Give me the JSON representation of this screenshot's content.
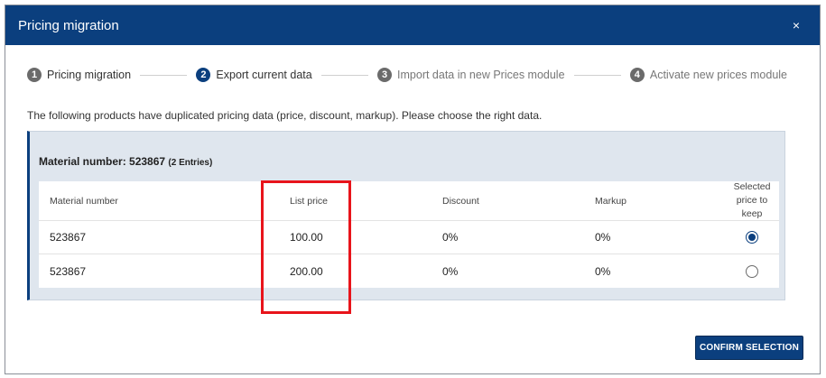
{
  "dialog": {
    "title": "Pricing migration",
    "close_label": "×"
  },
  "stepper": {
    "steps": [
      {
        "number": "1",
        "label": "Pricing migration",
        "state": "done"
      },
      {
        "number": "2",
        "label": "Export current data",
        "state": "active"
      },
      {
        "number": "3",
        "label": "Import data in new Prices module",
        "state": "upcoming"
      },
      {
        "number": "4",
        "label": "Activate new prices module",
        "state": "upcoming"
      }
    ]
  },
  "intro_text": "The following products have duplicated pricing data (price, discount, markup). Please choose the right data.",
  "group": {
    "title": "Material number: 523867",
    "entries": "(2 Entries)",
    "columns": {
      "material": "Material number",
      "list_price": "List price",
      "discount": "Discount",
      "markup": "Markup",
      "selected": "Selected price to keep"
    },
    "rows": [
      {
        "material": "523867",
        "list_price": "100.00",
        "discount": "0%",
        "markup": "0%",
        "selected": true
      },
      {
        "material": "523867",
        "list_price": "200.00",
        "discount": "0%",
        "markup": "0%",
        "selected": false
      }
    ]
  },
  "actions": {
    "confirm_label": "CONFIRM SELECTION"
  },
  "colors": {
    "header_bg": "#0b3f7e",
    "panel_bg": "#dfe6ee",
    "highlight": "#e8141b"
  }
}
